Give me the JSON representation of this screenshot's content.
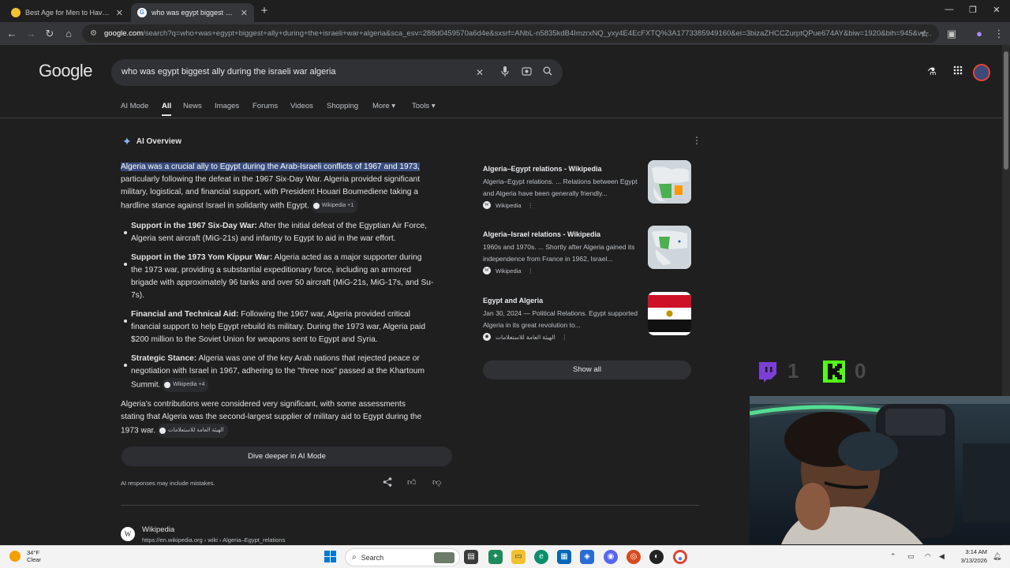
{
  "browser": {
    "tabs": [
      {
        "title": "Best Age for Men to Have Kids",
        "active": false
      },
      {
        "title": "who was egypt biggest ally du",
        "active": true
      }
    ],
    "url_host": "google.com",
    "url_rest": "/search?q=who+was+egypt+biggest+ally+during+the+israeli+war+algeria&sca_esv=288d0459570a6d4e&sxsrf=ANbL-n5835kdB4ImzrxNQ_yxy4E4EcFXTQ%3A1773385949160&ei=3bizaZHCCZurptQPue674AY&biw=1920&bih=945&ve..."
  },
  "google": {
    "logo": "Google",
    "query": "who was egypt biggest ally during the israeli war algeria",
    "tabs": [
      "AI Mode",
      "All",
      "News",
      "Images",
      "Forums",
      "Videos",
      "Shopping",
      "More ▾",
      "Tools ▾"
    ],
    "selected_tab": "All"
  },
  "ai_overview": {
    "heading": "AI Overview",
    "intro_highlight": "Algeria was a crucial ally to Egypt during the Arab-Israeli conflicts of 1967 and 1973,",
    "intro_rest_1": "particularly following the defeat in the 1967 Six-Day War. Algeria provided significant",
    "intro_rest_2": "military, logistical, and financial support, with President Houari Boumediene taking a",
    "intro_rest_3": "hardline stance against Israel in solidarity with Egypt.",
    "intro_cite": "Wikipedia +1",
    "bullets": [
      {
        "title": "Support in the 1967 Six-Day War:",
        "lines": [
          " After the initial defeat of the Egyptian Air Force,",
          "Algeria sent aircraft (MiG-21s) and infantry to Egypt to aid in the war effort."
        ]
      },
      {
        "title": "Support in the 1973 Yom Kippur War:",
        "lines": [
          " Algeria acted as a major supporter during",
          "the 1973 war, providing a substantial expeditionary force, including an armored",
          "brigade with approximately 96 tanks and over 50 aircraft (MiG-21s, MiG-17s, and Su-",
          "7s)."
        ]
      },
      {
        "title": "Financial and Technical Aid:",
        "lines": [
          " Following the 1967 war, Algeria provided critical",
          "financial support to help Egypt rebuild its military. During the 1973 war, Algeria paid",
          "$200 million to the Soviet Union for weapons sent to Egypt and Syria."
        ]
      },
      {
        "title": "Strategic Stance:",
        "lines": [
          " Algeria was one of the key Arab nations that rejected peace or",
          "negotiation with Israel in 1967, adhering to the \"three nos\" passed at the Khartoum",
          "Summit."
        ],
        "cite": "Wikipedia +4"
      }
    ],
    "closing": [
      "Algeria's contributions were considered very significant, with some assessments",
      "stating that Algeria was the second-largest supplier of military aid to Egypt during the",
      "1973 war."
    ],
    "closing_cite": "الهيئة العامة للاستعلامات",
    "dive_button": "Dive deeper in AI Mode",
    "disclaimer": "AI responses may include mistakes."
  },
  "sources": [
    {
      "title": "Algeria–Egypt relations - Wikipedia",
      "snippet": "Algeria–Egypt relations. ... Relations between Egypt and Algeria have been generally friendly...",
      "site": "Wikipedia",
      "thumb": "map-algeria-egypt"
    },
    {
      "title": "Algeria–Israel relations - Wikipedia",
      "snippet": "1960s and 1970s. ... Shortly after Algeria gained its independence from France in 1962, Israel...",
      "site": "Wikipedia",
      "thumb": "map-algeria-israel"
    },
    {
      "title": "Egypt and Algeria",
      "snippet": "Jan 30, 2024 — Political Relations. Egypt supported Algeria in its great revolution to...",
      "site": "الهيئة العامة للاستعلامات",
      "thumb": "egypt-flag"
    }
  ],
  "show_all": "Show all",
  "result": {
    "site_name": "Wikipedia",
    "url": "https://en.wikipedia.org › wiki › Algeria–Egypt_relations"
  },
  "overlay": {
    "twitch_count": "1",
    "kick_count": "0"
  },
  "taskbar": {
    "weather_temp": "34°F",
    "weather_desc": "Clear",
    "search_label": "Search",
    "time": "3:14 AM",
    "date": "3/13/2026"
  },
  "colors": {
    "highlight": "#394c7e",
    "accent": "#8ab4f8",
    "twitch": "#9146ff",
    "kick": "#53fc18"
  }
}
